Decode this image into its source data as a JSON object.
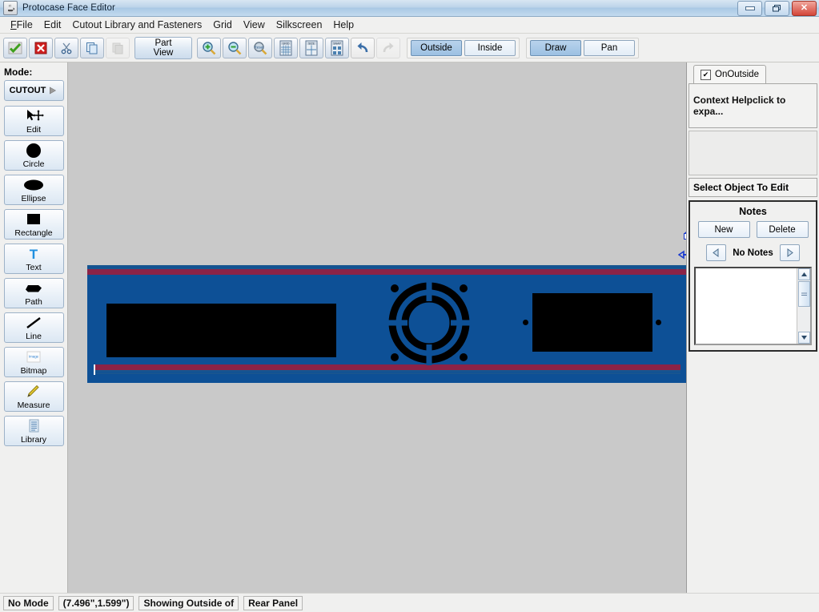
{
  "window": {
    "title": "Protocase Face Editor",
    "app_icon": "java-coffee-cup-icon",
    "buttons": {
      "minimize": "minimize",
      "restore": "restore",
      "close": "✕"
    }
  },
  "menubar": {
    "items": [
      {
        "label": "File",
        "mnemonic": "F"
      },
      {
        "label": "Edit",
        "mnemonic": "E"
      },
      {
        "label": "Cutout Library and Fasteners",
        "mnemonic": "C"
      },
      {
        "label": "Grid",
        "mnemonic": "d"
      },
      {
        "label": "View",
        "mnemonic": "V"
      },
      {
        "label": "Silkscreen",
        "mnemonic": "S"
      },
      {
        "label": "Help",
        "mnemonic": "H"
      }
    ]
  },
  "toolbar": {
    "icons": [
      {
        "name": "accept-check-icon",
        "tip": "Accept"
      },
      {
        "name": "cancel-x-icon",
        "tip": "Cancel"
      },
      {
        "name": "cut-scissors-icon",
        "tip": "Cut"
      },
      {
        "name": "copy-icon",
        "tip": "Copy"
      },
      {
        "name": "paste-icon",
        "tip": "Paste",
        "disabled": true
      }
    ],
    "part_view_line1": "Part",
    "part_view_line2": "View",
    "zoom_in": "zoom-in-icon",
    "zoom_out": "zoom-out-icon",
    "zoom_reset": "zoom-reset-icon",
    "zoom_reset_label": "Reset",
    "grid_label": "GRID",
    "size_label": "SIZE",
    "snap_label": "SNAP",
    "undo": "undo-icon",
    "redo": "redo-icon",
    "side_group": [
      {
        "label": "Outside",
        "selected": true
      },
      {
        "label": "Inside",
        "selected": false
      }
    ],
    "mouse_group": [
      {
        "label": "Draw",
        "selected": true
      },
      {
        "label": "Pan",
        "selected": false
      }
    ]
  },
  "rail": {
    "mode_label": "Mode:",
    "mode_button": "CUTOUT",
    "tools": [
      {
        "label": "Edit",
        "icon": "cursor-move-icon"
      },
      {
        "label": "Circle",
        "icon": "circle-icon"
      },
      {
        "label": "Ellipse",
        "icon": "ellipse-icon"
      },
      {
        "label": "Rectangle",
        "icon": "rectangle-icon"
      },
      {
        "label": "Text",
        "icon": "text-t-icon"
      },
      {
        "label": "Path",
        "icon": "path-polygon-icon"
      },
      {
        "label": "Line",
        "icon": "line-icon"
      },
      {
        "label": "Bitmap",
        "icon": "bitmap-image-icon"
      },
      {
        "label": "Measure",
        "icon": "measure-pencil-icon"
      },
      {
        "label": "Library",
        "icon": "library-list-icon"
      }
    ]
  },
  "canvas": {
    "background_color": "#c9c9c9",
    "panel": {
      "face_color": "#0d5096",
      "bend_color": "#8b2347",
      "edge_color": "#18558f",
      "cutout_color": "#000000",
      "cutouts": [
        {
          "name": "rectangle-cutout-left",
          "shape": "rect"
        },
        {
          "name": "fan-grill-cutout",
          "shape": "fan-grill"
        },
        {
          "name": "rectangle-cutout-right",
          "shape": "rect"
        },
        {
          "name": "hole-left",
          "shape": "circle"
        },
        {
          "name": "hole-right",
          "shape": "circle"
        }
      ]
    },
    "resize_cursor": "resize-arrow-cursor"
  },
  "rightpane": {
    "tab": {
      "label": "OnOutside",
      "checked": true,
      "check_glyph": "✔"
    },
    "context_help": "Context Helpclick to expa...",
    "select_object": "Select Object To Edit",
    "notes": {
      "title": "Notes",
      "new_label": "New",
      "delete_label": "Delete",
      "prev_label": "◀",
      "next_label": "▶",
      "counter": "No Notes",
      "text_value": ""
    }
  },
  "statusbar": {
    "mode": "No Mode",
    "coordinates": "(7.496\",1.599\")",
    "showing": "Showing Outside of",
    "part": "Rear Panel"
  }
}
